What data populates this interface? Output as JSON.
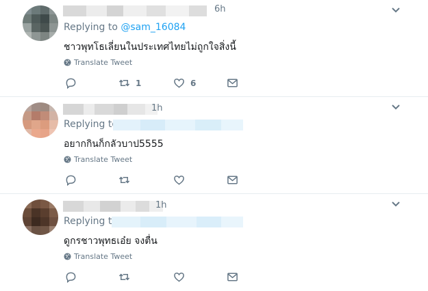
{
  "tweets": [
    {
      "time": "6h",
      "replying_label": "Replying to",
      "reply_handle": "@sam_16084",
      "text": "ชาวพุทโธเลี่ยนในประเทศไทยไม่ถูกใจสิ่งนี้",
      "translate_label": "Translate Tweet",
      "retweet_count": "1",
      "like_count": "6",
      "avatar_colors": [
        "#7f8c8f",
        "#6c7a7a",
        "#5f6b6b",
        "#8e9796",
        "#6e7b78",
        "#4f5b5a",
        "#3f4a4a",
        "#7c8683",
        "#9aa3a1",
        "#5a6563",
        "#4b5553",
        "#8d9593",
        "#b0b6b3",
        "#8e9694",
        "#7d8582",
        "#a7adab"
      ]
    },
    {
      "time": "1h",
      "replying_label": "Replying to",
      "reply_handle": "",
      "text": "อยากกินก็กลัวบาป5555",
      "translate_label": "Translate Tweet",
      "retweet_count": "",
      "like_count": "",
      "avatar_colors": [
        "#b8a49c",
        "#a08d86",
        "#9e8a80",
        "#c6b6ae",
        "#c59a86",
        "#b47c6a",
        "#c18c78",
        "#d2b3a5",
        "#d69a7e",
        "#e0a68a",
        "#dc9c7e",
        "#e6bca8",
        "#e0b8a6",
        "#eaa88c",
        "#e7a488",
        "#eec4b2"
      ]
    },
    {
      "time": "1h",
      "replying_label": "Replying to",
      "reply_handle": "",
      "text": "ดูกรชาวพุทธเอ๋ย จงตื่น",
      "translate_label": "Translate Tweet",
      "retweet_count": "",
      "like_count": "",
      "avatar_colors": [
        "#8a6a55",
        "#6f4f3c",
        "#7a5844",
        "#9a7a66",
        "#6a4c3a",
        "#4a3326",
        "#5a3e2e",
        "#7c5c48",
        "#5e4334",
        "#3d2a20",
        "#4d3528",
        "#6e5040",
        "#8a7062",
        "#6a5244",
        "#705646",
        "#9a8070"
      ]
    }
  ]
}
